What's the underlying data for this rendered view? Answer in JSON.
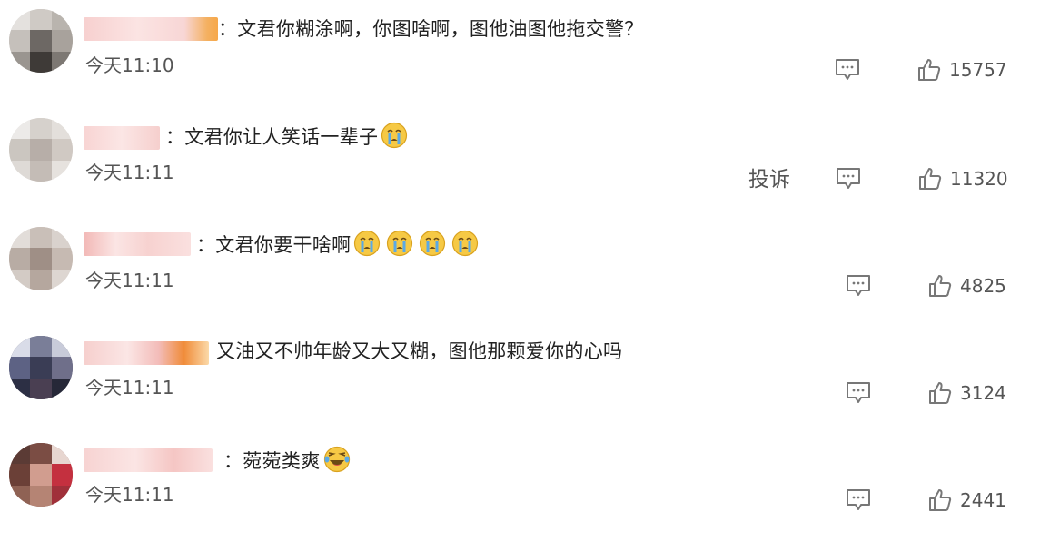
{
  "colors": {
    "text": "#222222",
    "meta": "#555555",
    "icon": "#777777",
    "emoji_face": "#f6c945"
  },
  "icons": {
    "reply": "comment-icon",
    "like": "thumbs-up-icon",
    "emoji_cry": "crying-face",
    "emoji_laugh": "laughing-face"
  },
  "comments": [
    {
      "text": "：文君你糊涂啊，你图啥啊，图他油图他拖交警？",
      "time": "今天11:10",
      "likes": "15757"
    },
    {
      "text": "：文君你让人笑话一辈子",
      "time": "今天11:11",
      "likes": "11320",
      "report": "投诉"
    },
    {
      "text": "：文君你要干啥啊",
      "time": "今天11:11",
      "likes": "4825"
    },
    {
      "text": "又油又不帅年龄又大又糊，图他那颗爱你的心吗",
      "time": "今天11:11",
      "likes": "3124"
    },
    {
      "text": "：菀菀类爽",
      "time": "今天11:11",
      "likes": "2441"
    }
  ]
}
